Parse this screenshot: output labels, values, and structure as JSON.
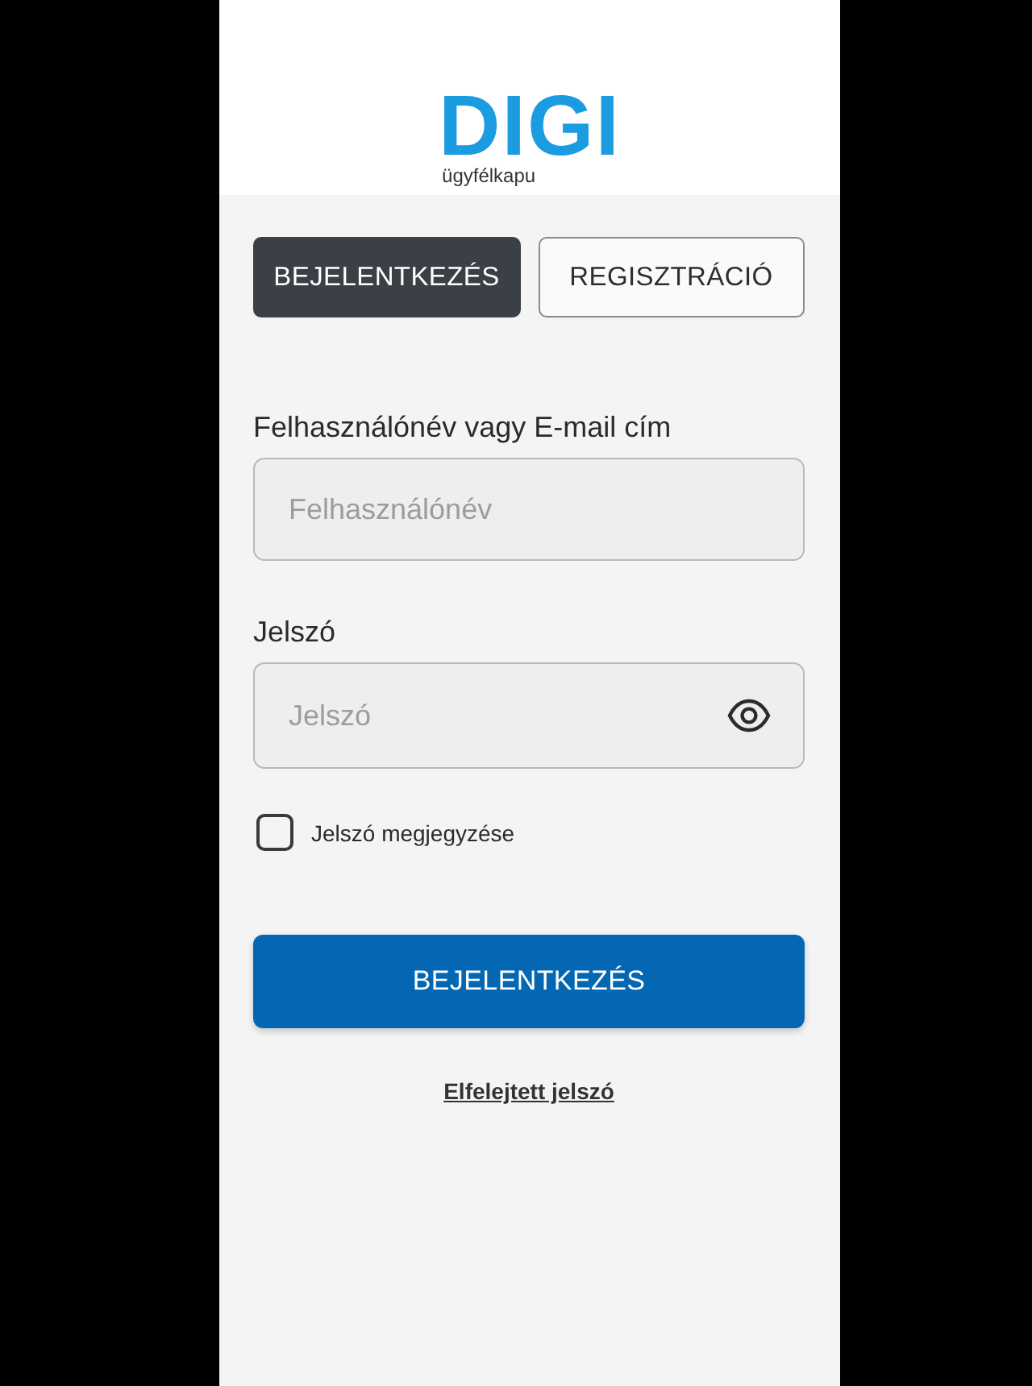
{
  "header": {
    "logo": {
      "text": "DIGI",
      "subtitle": "ügyfélkapu"
    }
  },
  "tabs": [
    {
      "label": "BEJELENTKEZÉS",
      "selected": true
    },
    {
      "label": "REGISZTRÁCIÓ",
      "selected": false
    }
  ],
  "form": {
    "fields": [
      {
        "kind": "text",
        "label": "Felhasználónév vagy E-mail cím",
        "placeholder": "Felhasználónév"
      },
      {
        "kind": "password",
        "label": "Jelszó",
        "placeholder": "Jelszó"
      }
    ],
    "remember": {
      "label": "Jelszó megjegyzése",
      "checked": false
    },
    "submit": "BEJELENTKEZÉS",
    "forgot_link": "Elfelejtett jelszó"
  }
}
